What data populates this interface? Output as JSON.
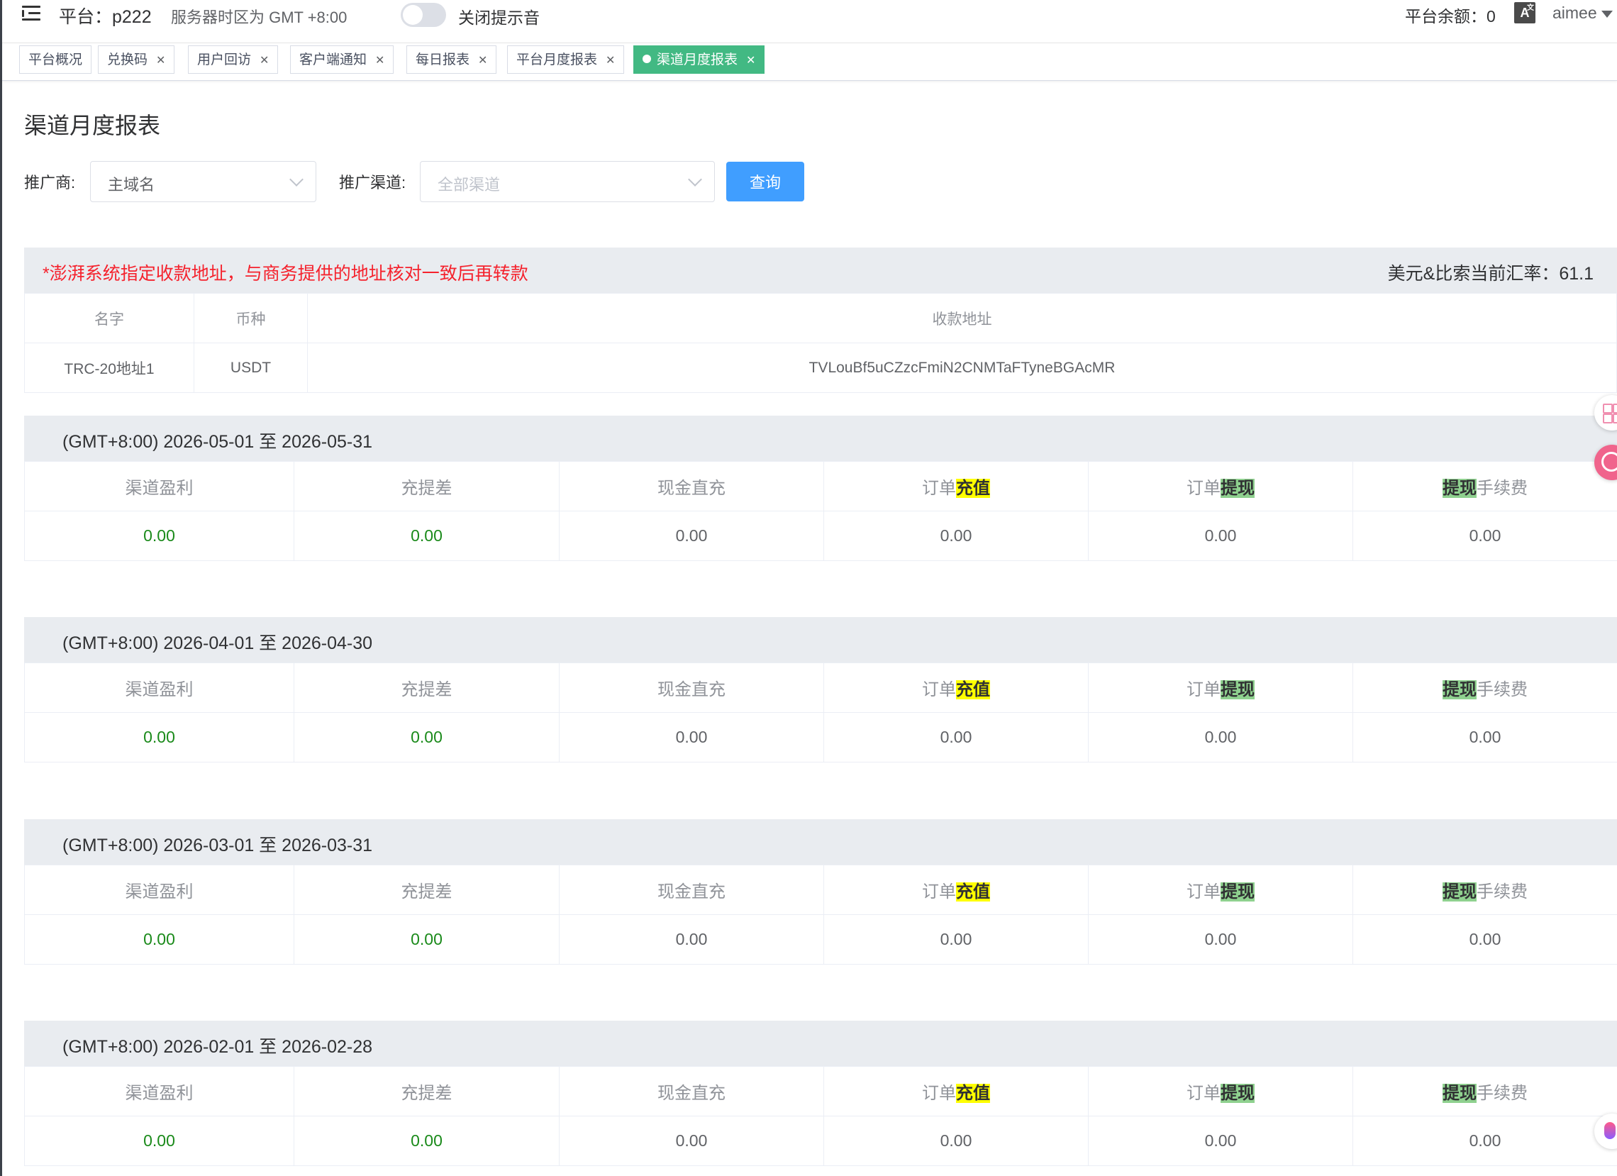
{
  "header": {
    "platform": "平台：p222",
    "timezone": "服务器时区为 GMT +8:00",
    "mute_label": "关闭提示音",
    "balance": "平台余额：0",
    "username": "aimee",
    "icons": [
      "menu-fold-icon",
      "translate-icon",
      "caret-down-icon"
    ]
  },
  "tags": [
    {
      "label": "平台概况",
      "closable": false
    },
    {
      "label": "兑换码",
      "closable": true
    },
    {
      "label": "用户回访",
      "closable": true
    },
    {
      "label": "客户端通知",
      "closable": true
    },
    {
      "label": "每日报表",
      "closable": true
    },
    {
      "label": "平台月度报表",
      "closable": true
    },
    {
      "label": "渠道月度报表",
      "closable": true,
      "active": true
    }
  ],
  "page": {
    "title": "渠道月度报表",
    "filters": {
      "promoter_label": "推广商:",
      "promoter_value": "主域名",
      "channel_label": "推广渠道:",
      "channel_placeholder": "全部渠道",
      "query_button": "查询"
    }
  },
  "address_section": {
    "warning": "*澎湃系统指定收款地址，与商务提供的地址核对一致后再转款",
    "rate": "美元&比索当前汇率：61.1",
    "columns": [
      "名字",
      "币种",
      "收款地址"
    ],
    "rows": [
      [
        "TRC-20地址1",
        "USDT",
        "TVLouBf5uCZzcFmiN2CNMTaFTyneBGAcMR"
      ]
    ]
  },
  "report_columns": {
    "profit": "渠道盈利",
    "diff": "充提差",
    "cash": "现金直充",
    "order_prefix": "订单",
    "recharge": "充值",
    "withdraw": "提现",
    "fee_suffix": "手续费"
  },
  "months": [
    {
      "range": "(GMT+8:00) 2026-05-01 至 2026-05-31",
      "values": [
        "0.00",
        "0.00",
        "0.00",
        "0.00",
        "0.00",
        "0.00"
      ]
    },
    {
      "range": "(GMT+8:00) 2026-04-01 至 2026-04-30",
      "values": [
        "0.00",
        "0.00",
        "0.00",
        "0.00",
        "0.00",
        "0.00"
      ]
    },
    {
      "range": "(GMT+8:00) 2026-03-01 至 2026-03-31",
      "values": [
        "0.00",
        "0.00",
        "0.00",
        "0.00",
        "0.00",
        "0.00"
      ]
    },
    {
      "range": "(GMT+8:00) 2026-02-01 至 2026-02-28",
      "values": [
        "0.00",
        "0.00",
        "0.00",
        "0.00",
        "0.00",
        "0.00"
      ]
    }
  ],
  "colors": {
    "active_tag": "#42b983",
    "primary_button": "#409eff",
    "warning_text": "#f5222d",
    "positive_value": "#1a8a1a",
    "highlight_yellow": "#ffff00",
    "highlight_green": "#8fd18f"
  }
}
